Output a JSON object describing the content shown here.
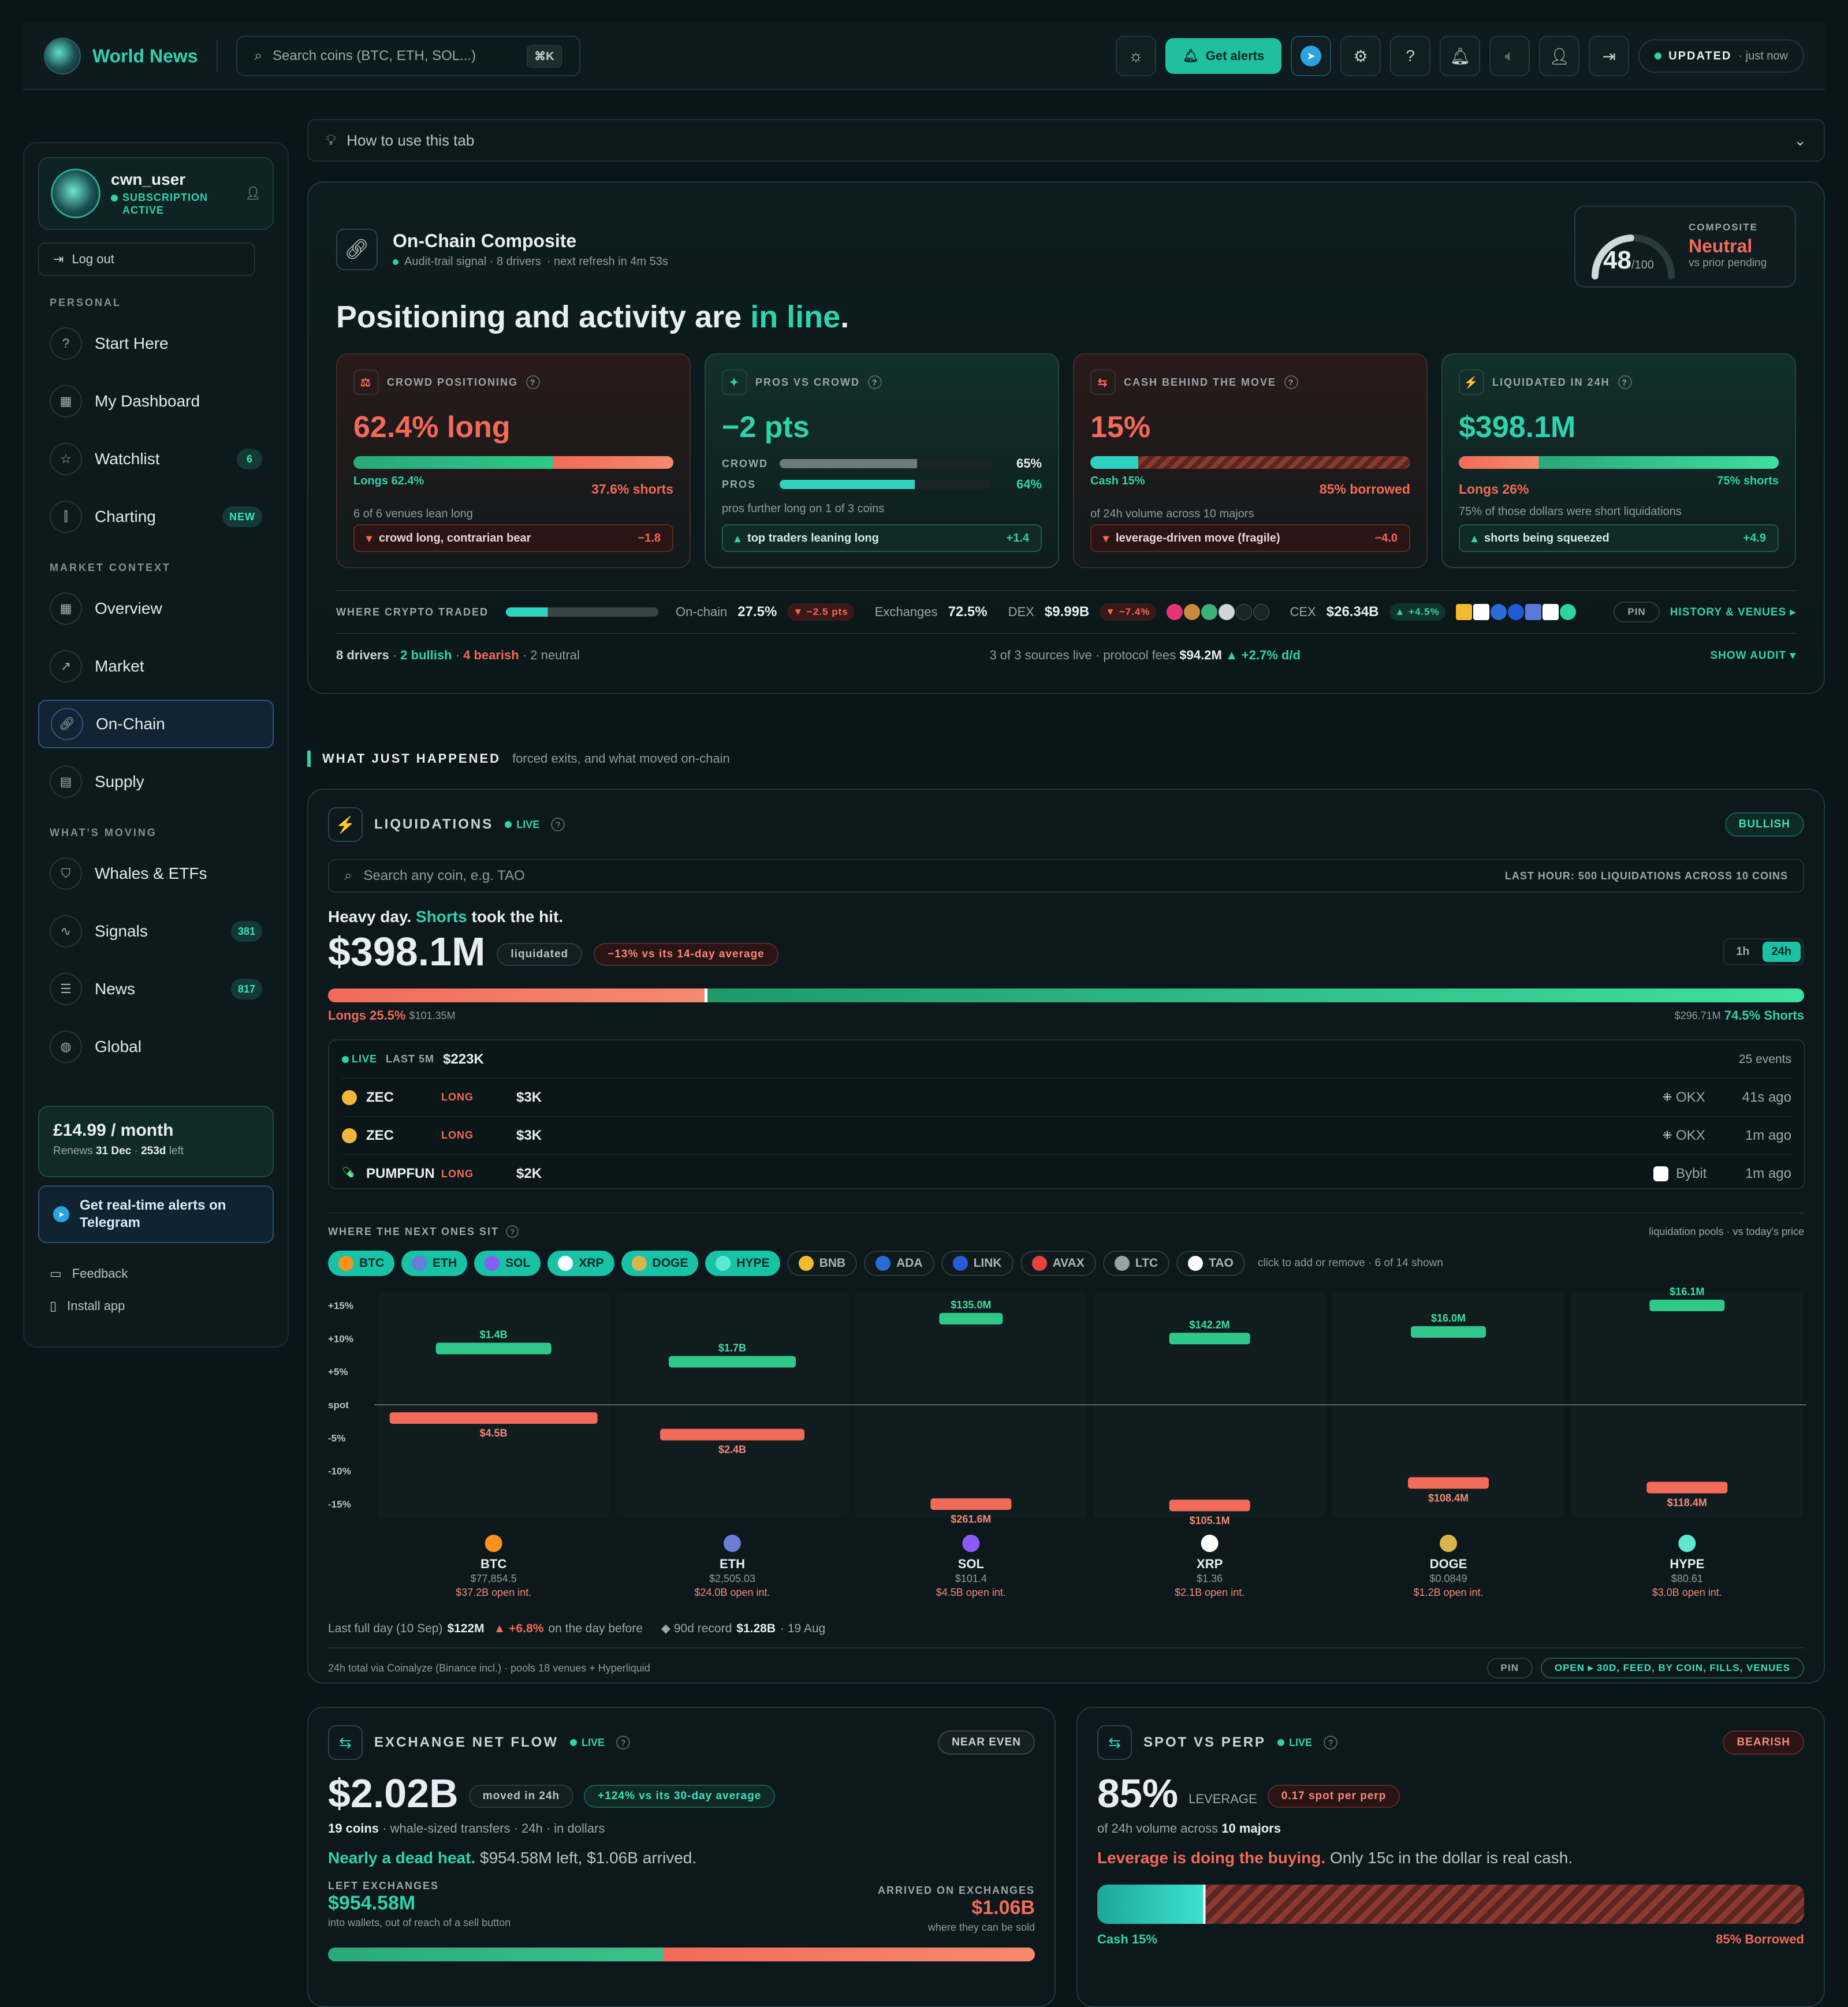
{
  "topbar": {
    "brand": "World News",
    "search_placeholder": "Search coins (BTC, ETH, SOL...)",
    "search_kbd": "⌘K",
    "alerts_label": "Get alerts",
    "updated_label": "UPDATED",
    "updated_time": "· just now"
  },
  "sidebar": {
    "username": "cwn_user",
    "subscription": "SUBSCRIPTION ACTIVE",
    "logout": "Log out",
    "sections": {
      "personal": "PERSONAL",
      "market": "MARKET CONTEXT",
      "moving": "WHAT'S MOVING"
    },
    "items": [
      {
        "label": "Start Here",
        "icon": "help-circle-icon"
      },
      {
        "label": "My Dashboard",
        "icon": "dashboard-icon"
      },
      {
        "label": "Watchlist",
        "icon": "star-icon",
        "badge": "6"
      },
      {
        "label": "Charting",
        "icon": "candles-icon",
        "badge": "NEW"
      },
      {
        "label": "Overview",
        "icon": "grid-icon"
      },
      {
        "label": "Market",
        "icon": "trend-icon"
      },
      {
        "label": "On-Chain",
        "icon": "link-icon"
      },
      {
        "label": "Supply",
        "icon": "layout-icon"
      },
      {
        "label": "Whales & ETFs",
        "icon": "shield-icon"
      },
      {
        "label": "Signals",
        "icon": "pulse-icon",
        "badge": "381"
      },
      {
        "label": "News",
        "icon": "newspaper-icon",
        "badge": "817"
      },
      {
        "label": "Global",
        "icon": "globe-icon"
      }
    ],
    "price": "£14.99 / month",
    "renews_prefix": "Renews",
    "renews_date": "31 Dec",
    "renews_sep": "·",
    "renews_left": "253d",
    "renews_suffix": "left",
    "telegram": "Get real-time alerts on Telegram",
    "feedback": "Feedback",
    "install": "Install app"
  },
  "howto": "How to use this tab",
  "composite": {
    "title": "On-Chain Composite",
    "subtitle": "Audit-trail signal · 8 drivers",
    "refresh": "· next refresh in 4m 53s",
    "score": "48",
    "score_max": "/100",
    "score_fraction": 0.48,
    "label": "COMPOSITE",
    "state": "Neutral",
    "vs": "vs prior pending",
    "headline_a": "Positioning and activity are",
    "headline_b": "in line",
    "headline_c": ".",
    "cards": [
      {
        "label": "CROWD POSITIONING",
        "value": "62.4% long",
        "left": "Longs 62.4%",
        "right": "37.6% shorts",
        "note": "6 of 6 venues lean long",
        "chip": "crowd long, contrarian bear",
        "chip_val": "−1.8"
      },
      {
        "label": "PROS VS CROWD",
        "value": "−2 pts",
        "crowd_label": "CROWD",
        "crowd_val": "65%",
        "pros_label": "PROS",
        "pros_val": "64%",
        "note": "pros further long on 1 of 3 coins",
        "chip": "top traders leaning long",
        "chip_val": "+1.4"
      },
      {
        "label": "CASH BEHIND THE MOVE",
        "value": "15%",
        "left": "Cash 15%",
        "right": "85% borrowed",
        "note": "of 24h volume across 10 majors",
        "chip": "leverage-driven move (fragile)",
        "chip_val": "−4.0"
      },
      {
        "label": "LIQUIDATED IN 24H",
        "value": "$398.1M",
        "left": "Longs 26%",
        "right": "75% shorts",
        "note": "75% of those dollars were short liquidations",
        "chip": "shorts being squeezed",
        "chip_val": "+4.9"
      }
    ],
    "where": {
      "label": "WHERE CRYPTO TRADED",
      "onchain_label": "On-chain",
      "onchain_val": "27.5%",
      "onchain_chg": "▼ −2.5 pts",
      "ex_label": "Exchanges",
      "ex_val": "72.5%",
      "dex_label": "DEX",
      "dex_val": "$9.99B",
      "dex_chg": "▼ −7.4%",
      "cex_label": "CEX",
      "cex_val": "$26.34B",
      "cex_chg": "▲ +4.5%",
      "pin": "PIN",
      "history": "HISTORY & VENUES ▸"
    },
    "audit": {
      "drivers": "8 drivers",
      "bullish": "2 bullish",
      "bearish": "4 bearish",
      "neutral": "· 2 neutral",
      "sources": "3 of 3 sources live · protocol fees",
      "fees": "$94.2M",
      "fees_chg": "▲ +2.7% d/d",
      "show": "SHOW AUDIT ▾"
    }
  },
  "what_happened": {
    "title": "WHAT JUST HAPPENED",
    "sub": "forced exits, and what moved on-chain"
  },
  "liquidations": {
    "title": "LIQUIDATIONS",
    "live": "LIVE",
    "badge": "BULLISH",
    "search_placeholder": "Search any coin, e.g. TAO",
    "last_hour": "LAST HOUR: 500 LIQUIDATIONS ACROSS 10 COINS",
    "heavy_a": "Heavy day.",
    "heavy_b": "Shorts",
    "heavy_c": "took the hit.",
    "total": "$398.1M",
    "liquidated": "liquidated",
    "vs_avg": "−13% vs its 14-day average",
    "range_1h": "1h",
    "range_24h": "24h",
    "longs_label": "Longs 25.5%",
    "longs_amt": "$101.35M",
    "shorts_amt": "$296.71M",
    "shorts_label": "74.5% Shorts",
    "long_fraction": 0.255,
    "feed_live": "LIVE",
    "feed_window": "LAST 5M",
    "feed_total": "$223K",
    "feed_events": "25 events",
    "feed": [
      {
        "coin": "ZEC",
        "side": "LONG",
        "amt": "$3K",
        "venue": "OKX",
        "ago": "41s ago"
      },
      {
        "coin": "ZEC",
        "side": "LONG",
        "amt": "$3K",
        "venue": "OKX",
        "ago": "1m ago"
      },
      {
        "coin": "PUMPFUN",
        "side": "LONG",
        "amt": "$2K",
        "venue": "Bybit",
        "ago": "1m ago"
      }
    ],
    "next_label": "WHERE THE NEXT ONES SIT",
    "pools_note": "liquidation pools · vs today's price",
    "coins": [
      {
        "sym": "BTC",
        "on": true,
        "color": "#f7931a"
      },
      {
        "sym": "ETH",
        "on": true,
        "color": "#6a7bd8"
      },
      {
        "sym": "SOL",
        "on": true,
        "color": "#8a5cf6"
      },
      {
        "sym": "XRP",
        "on": true,
        "color": "#ffffff"
      },
      {
        "sym": "DOGE",
        "on": true,
        "color": "#d8b54a"
      },
      {
        "sym": "HYPE",
        "on": true,
        "color": "#5ee8d0"
      },
      {
        "sym": "BNB",
        "on": false,
        "color": "#f3ba2f"
      },
      {
        "sym": "ADA",
        "on": false,
        "color": "#2a6bd8"
      },
      {
        "sym": "LINK",
        "on": false,
        "color": "#2a5ada"
      },
      {
        "sym": "AVAX",
        "on": false,
        "color": "#e84142"
      },
      {
        "sym": "LTC",
        "on": false,
        "color": "#9aa0a6"
      },
      {
        "sym": "TAO",
        "on": false,
        "color": "#ffffff"
      }
    ],
    "chips_hint": "click to add or remove · 6 of 14 shown",
    "last_day_a": "Last full day (10 Sep)",
    "last_day_val": "$122M",
    "last_day_chg": "▲ +6.8%",
    "last_day_b": "on the day before",
    "record_a": "◆ 90d record",
    "record_val": "$1.28B",
    "record_b": "· 19 Aug",
    "footer_note": "24h total via Coinalyze (Binance incl.) · pools 18 venues + Hyperliquid",
    "pin": "PIN",
    "open": "OPEN ▸ 30D, FEED, BY COIN, FILLS, VENUES"
  },
  "chart_data": {
    "type": "bar",
    "ylabel": "",
    "y_ticks": [
      "+15%",
      "+10%",
      "+5%",
      "spot",
      "-5%",
      "-10%",
      "-15%"
    ],
    "ylim": [
      -17,
      17
    ],
    "categories": [
      "BTC",
      "ETH",
      "SOL",
      "XRP",
      "DOGE",
      "HYPE"
    ],
    "prices": [
      "$77,854.5",
      "$2,505.03",
      "$101.4",
      "$1.36",
      "$0.0849",
      "$80.61"
    ],
    "open_interest": [
      "$37.2B open int.",
      "$24.0B open int.",
      "$4.5B open int.",
      "$2.1B open int.",
      "$1.2B open int.",
      "$3.0B open int."
    ],
    "series": [
      {
        "name": "short pools",
        "pct": [
          8.5,
          6.5,
          13,
          10,
          11,
          15
        ],
        "labels": [
          "$1.4B",
          "$1.7B",
          "$135.0M",
          "$142.2M",
          "$16.0M",
          "$16.1M"
        ]
      },
      {
        "name": "long pools",
        "pct": [
          -2,
          -4.5,
          -15,
          -15.2,
          -11.8,
          -12.5
        ],
        "labels": [
          "$4.5B",
          "$2.4B",
          "$261.6M",
          "$105.1M",
          "$108.4M",
          "$118.4M"
        ]
      }
    ]
  },
  "netflow": {
    "title": "EXCHANGE NET FLOW",
    "live": "LIVE",
    "badge": "NEAR EVEN",
    "total": "$2.02B",
    "moved": "moved in 24h",
    "vs": "+124% vs its 30-day average",
    "coins": "19 coins",
    "coins_sub": "· whale-sized transfers · 24h · in dollars",
    "heat_a": "Nearly a dead heat.",
    "heat_b": "$954.58M left, $1.06B arrived.",
    "left_label": "LEFT EXCHANGES",
    "left_val": "$954.58M",
    "left_sub": "into wallets, out of reach of a sell button",
    "arr_label": "ARRIVED ON EXCHANGES",
    "arr_val": "$1.06B",
    "arr_sub": "where they can be sold"
  },
  "spotperp": {
    "title": "SPOT VS PERP",
    "live": "LIVE",
    "badge": "BEARISH",
    "value": "85%",
    "lev": "LEVERAGE",
    "chip": "0.17 spot per perp",
    "sub_a": "of 24h volume across",
    "sub_b": "10 majors",
    "line_a": "Leverage is doing the buying.",
    "line_b": "Only 15c in the dollar is real cash.",
    "cash": "Cash 15%",
    "borrowed": "85% Borrowed",
    "cash_fraction": 0.15
  }
}
